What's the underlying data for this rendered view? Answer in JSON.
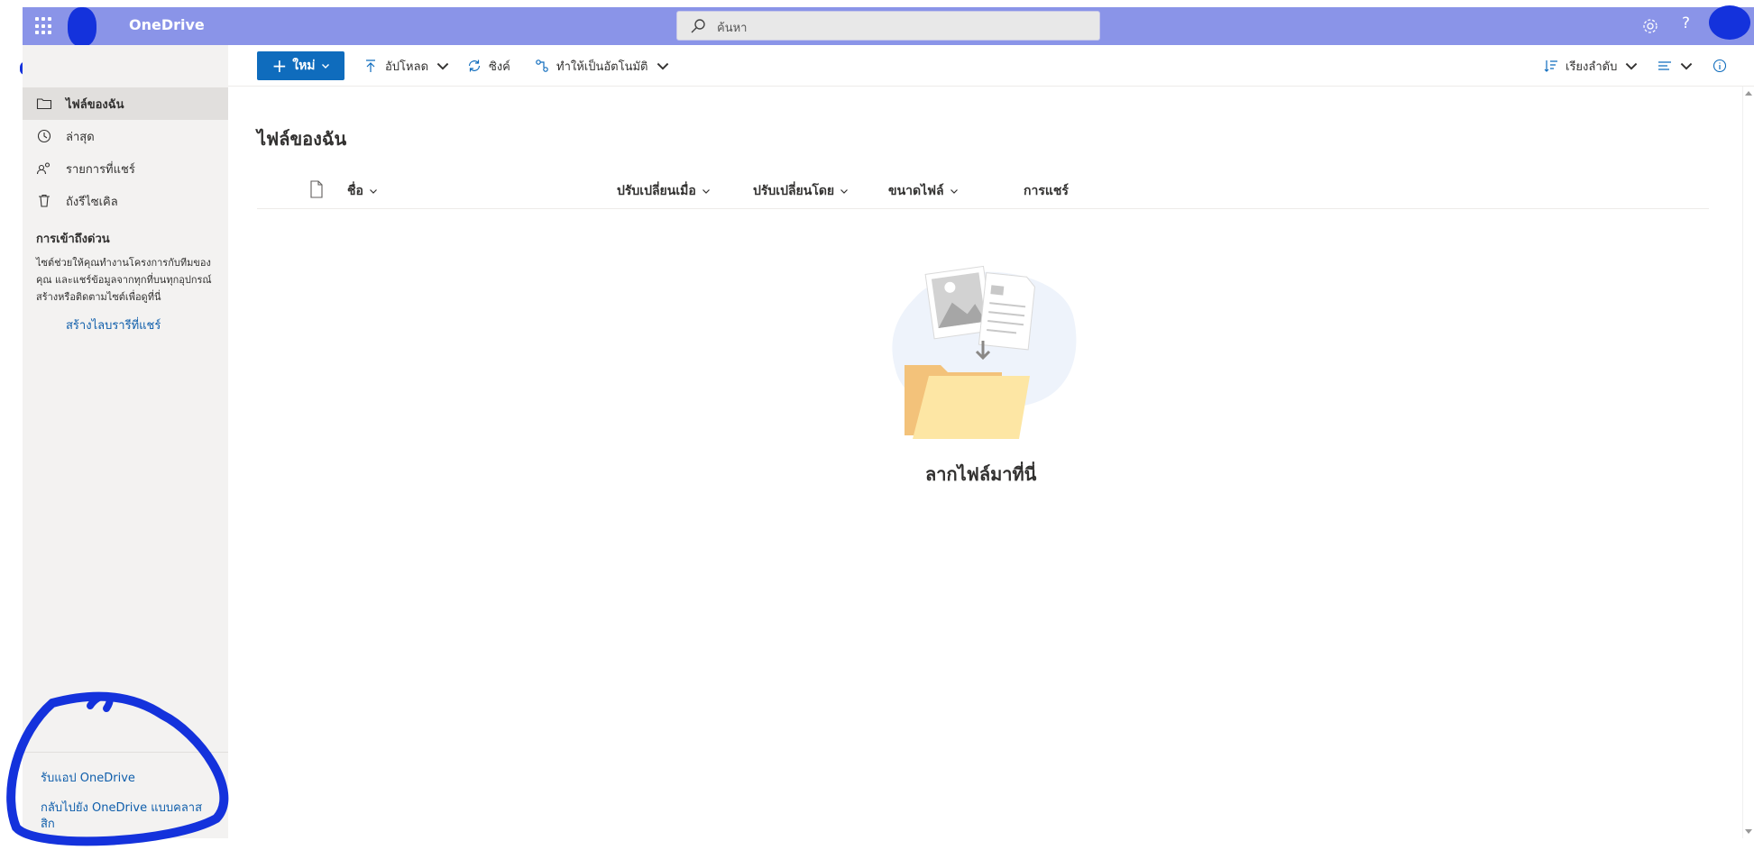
{
  "app": {
    "title": "OneDrive"
  },
  "search": {
    "placeholder": "ค้นหา"
  },
  "sidebar": {
    "items": [
      {
        "label": "ไฟล์ของฉัน",
        "icon": "folder-icon",
        "active": true
      },
      {
        "label": "ล่าสุด",
        "icon": "history-icon",
        "active": false
      },
      {
        "label": "รายการที่แชร์",
        "icon": "shared-people-icon",
        "active": false
      },
      {
        "label": "ถังรีไซเคิล",
        "icon": "recycle-bin-icon",
        "active": false
      }
    ],
    "quick_access_title": "การเข้าถึงด่วน",
    "quick_access_desc": "ไซต์ช่วยให้คุณทำงานโครงการกับทีมของคุณ และแชร์ข้อมูลจากทุกที่บนทุกอุปกรณ์ สร้างหรือติดตามไซต์เพื่อดูที่นี่",
    "create_library": "สร้างไลบรารีที่แชร์",
    "get_app": "รับแอป OneDrive",
    "classic": "กลับไปยัง OneDrive แบบคลาสสิก"
  },
  "toolbar": {
    "new": "ใหม่",
    "upload": "อัปโหลด",
    "sync": "ซิงค์",
    "automate": "ทำให้เป็นอัตโนมัติ",
    "sort": "เรียงลำดับ"
  },
  "main": {
    "title": "ไฟล์ของฉัน",
    "columns": {
      "name": "ชื่อ",
      "modified": "ปรับเปลี่ยนเมื่อ",
      "modified_by": "ปรับเปลี่ยนโดย",
      "file_size": "ขนาดไฟล์",
      "sharing": "การแชร์"
    },
    "empty_caption": "ลากไฟล์มาที่นี่"
  },
  "colors": {
    "topbar": "#8a94e8",
    "accent": "#0f6cbd",
    "link": "#0f5eab",
    "sidebar": "#f3f2f1",
    "redaction": "#1432dc"
  }
}
